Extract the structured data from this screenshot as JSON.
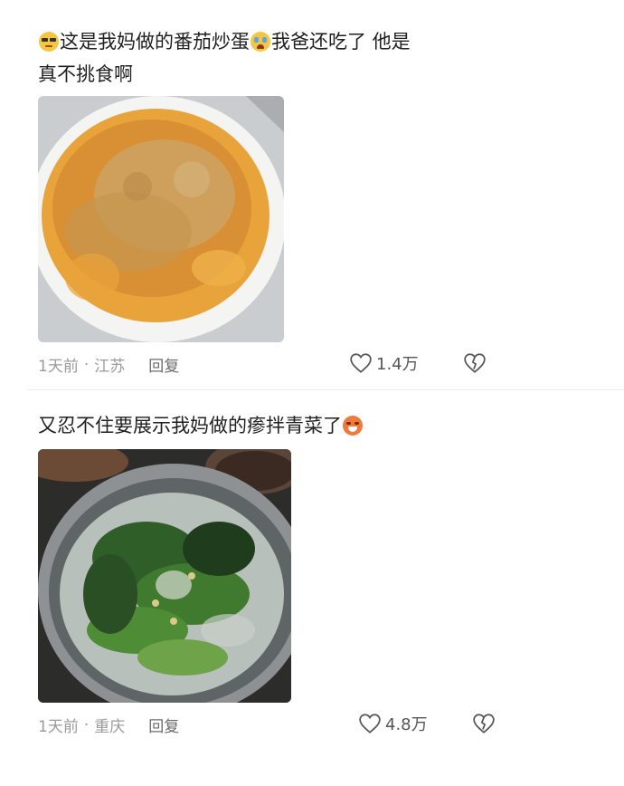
{
  "comments": [
    {
      "text_a": "这是我妈做的番茄炒蛋",
      "text_b": "我爸还吃了 他是",
      "text_c": "真不挑食啊",
      "emoji_1": "sunglasses-face-emoji",
      "emoji_2": "crying-face-emoji",
      "time": "1天前",
      "location": "江苏",
      "reply_label": "回复",
      "likes": "1.4万",
      "photo_desc_icon": "tomato-egg-dish"
    },
    {
      "text_a": "又忍不住要展示我妈做的瘆拌青菜了",
      "emoji_1": "laughing-crying-face-emoji",
      "time": "1天前",
      "location": "重庆",
      "reply_label": "回复",
      "likes": "4.8万",
      "photo_desc_icon": "greens-soup-dish"
    }
  ],
  "colors": {
    "meta_text": "#9a9a9a",
    "reply_text": "#6a6a6a",
    "divider": "#ececec"
  }
}
